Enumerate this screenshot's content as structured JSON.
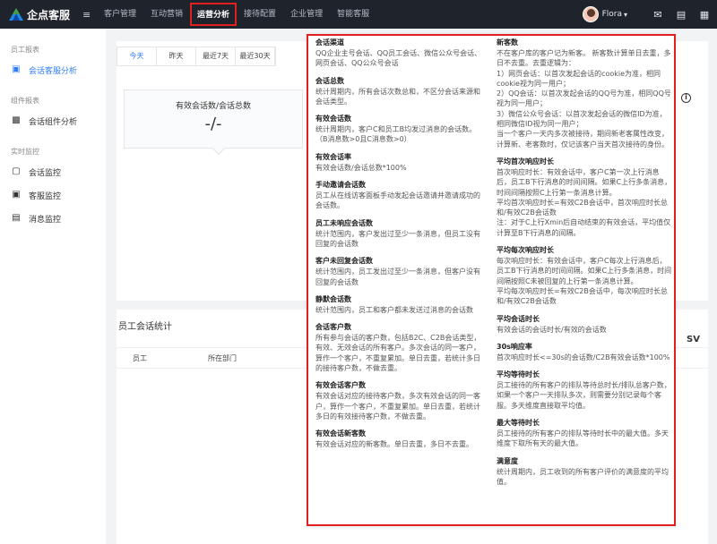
{
  "topbar": {
    "logo_text": "企点客服",
    "nav": [
      "客户管理",
      "互动营销",
      "运营分析",
      "接待配置",
      "企业管理",
      "智能客服"
    ],
    "active_nav": 2,
    "user_name": "Flora"
  },
  "sidebar": {
    "group1": "员工报表",
    "item1": "会话客服分析",
    "group2": "组件报表",
    "item2": "会话组件分析",
    "group3": "实时监控",
    "item3": "会话监控",
    "item4": "客服监控",
    "item5": "消息监控"
  },
  "tabs": [
    "今天",
    "昨天",
    "最近7天",
    "最近30天"
  ],
  "metric": {
    "label": "有效会话数/会话总数",
    "value": "-/-"
  },
  "info_icon": "i",
  "staff_section": {
    "title": "员工会话统计",
    "csv_label": "SV",
    "columns": [
      "员工",
      "所在部门"
    ]
  },
  "popover": {
    "left": [
      {
        "title": "会话渠道",
        "text": "QQ企业主号会话、QQ员工会话、微信公众号会话、网页会话、QQ公众号会话"
      },
      {
        "title": "会话总数",
        "text": "统计周期内，所有会话次数总和，不区分会话来源和会话类型。"
      },
      {
        "title": "有效会话数",
        "text": "统计周期内，客户C和员工B均发过消息的会话数。\n（B消息数>0且C消息数>0）"
      },
      {
        "title": "有效会话率",
        "text": "有效会话数/会话总数*100%"
      },
      {
        "title": "手动邀请会话数",
        "text": "员工从在线访客面板手动发起会话邀请并邀请成功的会话数。"
      },
      {
        "title": "员工未响应会话数",
        "text": "统计范围内，客户发出过至少一条消息，但员工没有回复的会话数"
      },
      {
        "title": "客户未回复会话数",
        "text": "统计范围内，员工发出过至少一条消息，但客户没有回复的会话数"
      },
      {
        "title": "静默会话数",
        "text": "统计范围内，员工和客户都未发送过消息的会话数"
      },
      {
        "title": "会话客户数",
        "text": "所有参与会话的客户数，包括B2C、C2B会话类型，有效、无效会话的所有客户。多次会话的同一客户，算作一个客户，不重复累加。单日去重，若统计多日的接待客户数，不做去重。"
      },
      {
        "title": "有效会话客户数",
        "text": "有效会话对应的接待客户数，多次有效会话的同一客户，算作一个客户，不重复累加。单日去重，若统计多日的有效接待客户数，不做去重。"
      },
      {
        "title": "有效会话新客数",
        "text": "有效会话对应的新客数。单日去重，多日不去重。"
      }
    ],
    "right": [
      {
        "title": "新客数",
        "text": "不在客户库的客户记为新客。 新客数计算单日去重，多日不去重。去重逻辑为：\n1）网页会话：以首次发起会话的cookie为准，相同cookie视为同一用户；\n2）QQ会话：以首次发起会话的QQ号为准，相同QQ号视为同一用户；\n3）微信公众号会话：以首次发起会话的微信ID为准，相同微信ID视为同一用户；\n当一个客户一天内多次被接待，期间新老客属性改变，计算新、老客数时，仅记该客户当天首次接待的身份。"
      },
      {
        "title": "平均首次响应时长",
        "text": "首次响应时长：有效会话中，客户C第一次上行消息后，员工B下行消息的时间间隔。如果C上行多条消息，时间间隔按照C上行第一条消息计算。\n平均首次响应时长=有效C2B会话中，首次响应时长总和/有效C2B会话数\n注：对于C上行Xmin后自动结束的有效会话，平均值仅计算至B下行消息的间隔。"
      },
      {
        "title": "平均每次响应时长",
        "text": "每次响应时长：有效会话中，客户C每次上行消息后，员工B下行消息的时间间隔。如果C上行多条消息，时间间隔按照C未被回复的上行第一条消息计算。\n平均每次响应时长=有效C2B会话中，每次响应时长总和/有效C2B会话数"
      },
      {
        "title": "平均会话时长",
        "text": "有效会话的会话时长/有效的会话数"
      },
      {
        "title": "30s响应率",
        "text": "首次响应时长<=30s的会话数/C2B有效会话数*100%"
      },
      {
        "title": "平均等待时长",
        "text": "员工接待的所有客户的排队等待总时长/排队总客户数，如果一个客户一天排队多次，则需要分别记录每个客服。多天维度直接取平均值。"
      },
      {
        "title": "最大等待时长",
        "text": "员工接待的所有客户的排队等待时长中的最大值。多天维度下取所有天的最大值。"
      },
      {
        "title": "满意度",
        "text": "统计周期内，员工收到的所有客户评价的满意度的平均值。"
      }
    ]
  }
}
